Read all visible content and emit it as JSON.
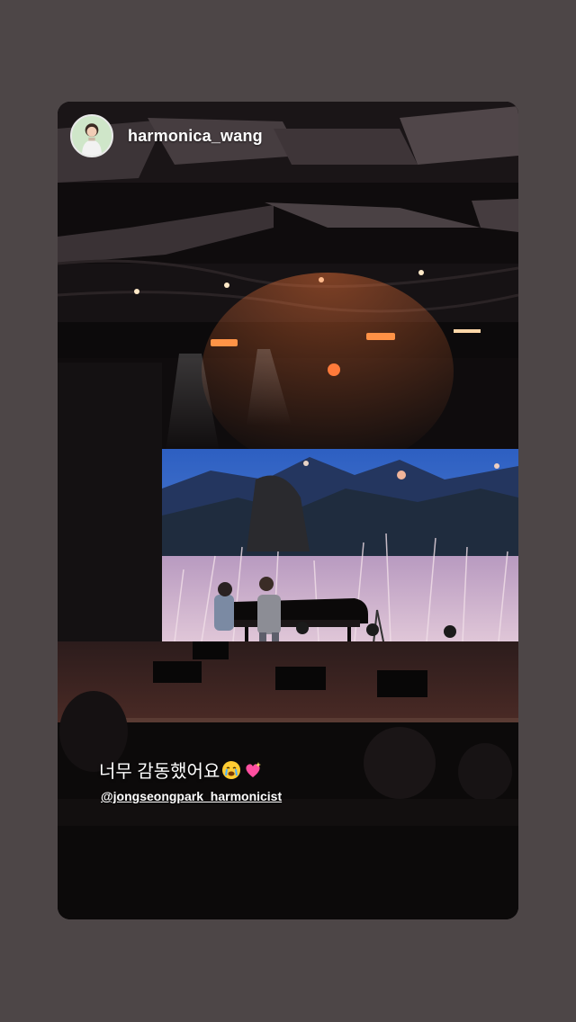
{
  "story": {
    "username": "harmonica_wang",
    "caption_text": "너무 감동했어요",
    "caption_emojis": [
      "crying-face-icon",
      "sparkling-heart-icon"
    ],
    "mention": "@jongseongpark_harmonicist"
  },
  "colors": {
    "page_background": "#4d4647",
    "screen_sky": "#2f5fb8",
    "screen_grass": "#c9a7c6",
    "stage_floor": "#3a2321"
  }
}
